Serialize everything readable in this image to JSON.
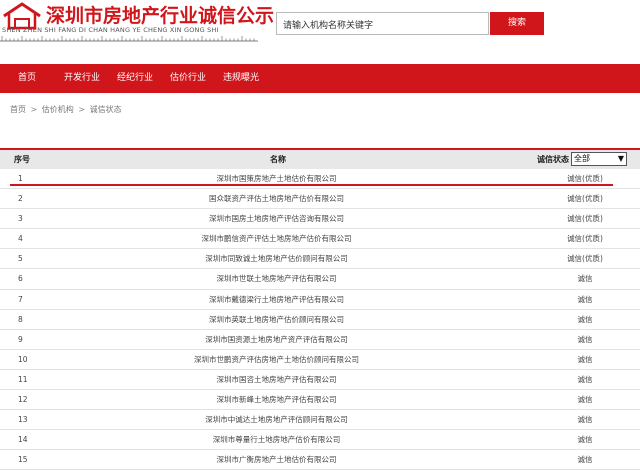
{
  "header": {
    "site_title": "深圳市房地产行业诚信公示",
    "site_pinyin": "SHEN ZHEN SHI FANG DI CHAN HANG YE CHENG XIN GONG SHI",
    "search_placeholder": "请输入机构名称关键字",
    "search_button": "搜索"
  },
  "nav": {
    "items": [
      "首页",
      "开发行业",
      "经纪行业",
      "估价行业",
      "违规曝光"
    ]
  },
  "breadcrumb": [
    "首页",
    "估价机构",
    "诚信状态"
  ],
  "table": {
    "col_no": "序号",
    "col_name": "名称",
    "col_status": "诚信状态",
    "status_filter_value": "全部",
    "rows": [
      {
        "no": "1",
        "name": "深圳市国策房地产土地估价有限公司",
        "status": "诚信(优质)"
      },
      {
        "no": "2",
        "name": "国众联资产评估土地房地产估价有限公司",
        "status": "诚信(优质)"
      },
      {
        "no": "3",
        "name": "深圳市国房土地房地产评估咨询有限公司",
        "status": "诚信(优质)"
      },
      {
        "no": "4",
        "name": "深圳市鹏信资产评估土地房地产估价有限公司",
        "status": "诚信(优质)"
      },
      {
        "no": "5",
        "name": "深圳市同致诚土地房地产估价顾问有限公司",
        "status": "诚信(优质)"
      },
      {
        "no": "6",
        "name": "深圳市世联土地房地产评估有限公司",
        "status": "诚信"
      },
      {
        "no": "7",
        "name": "深圳市戴德梁行土地房地产评估有限公司",
        "status": "诚信"
      },
      {
        "no": "8",
        "name": "深圳市英联土地房地产估价顾问有限公司",
        "status": "诚信"
      },
      {
        "no": "9",
        "name": "深圳市国资源土地房地产资产评估有限公司",
        "status": "诚信"
      },
      {
        "no": "10",
        "name": "深圳市世鹏资产评估房地产土地估价顾问有限公司",
        "status": "诚信"
      },
      {
        "no": "11",
        "name": "深圳市国咨土地房地产评估有限公司",
        "status": "诚信"
      },
      {
        "no": "12",
        "name": "深圳市新峰土地房地产评估有限公司",
        "status": "诚信"
      },
      {
        "no": "13",
        "name": "深圳市中诚达土地房地产评估顾问有限公司",
        "status": "诚信"
      },
      {
        "no": "14",
        "name": "深圳市尊量行土地房地产估价有限公司",
        "status": "诚信"
      },
      {
        "no": "15",
        "name": "深圳市广衡房地产土地估价有限公司",
        "status": "诚信"
      }
    ]
  },
  "colors": {
    "brand_red": "#d0161b",
    "header_gray": "#e8e8e8"
  }
}
